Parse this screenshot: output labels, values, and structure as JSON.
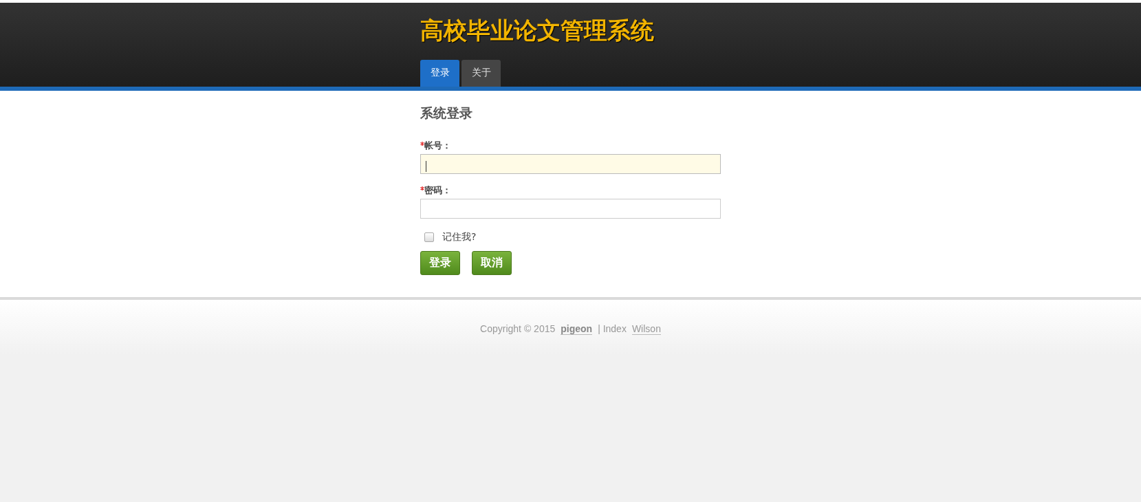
{
  "header": {
    "title": "高校毕业论文管理系统"
  },
  "tabs": [
    {
      "label": "登录",
      "selected": true
    },
    {
      "label": "关于",
      "selected": false
    }
  ],
  "form": {
    "heading": "系统登录",
    "fields": [
      {
        "label": "帐号：",
        "required": true,
        "focused": true
      },
      {
        "label": "密码：",
        "required": true,
        "focused": false
      }
    ],
    "remember": {
      "label": "记住我?",
      "checked": false
    },
    "buttons": [
      "登录",
      "取消"
    ]
  },
  "footer": {
    "copyright": "Copyright © 2015",
    "author_link": "pigeon",
    "index_text": "| Index",
    "site_link": "Wilson"
  }
}
